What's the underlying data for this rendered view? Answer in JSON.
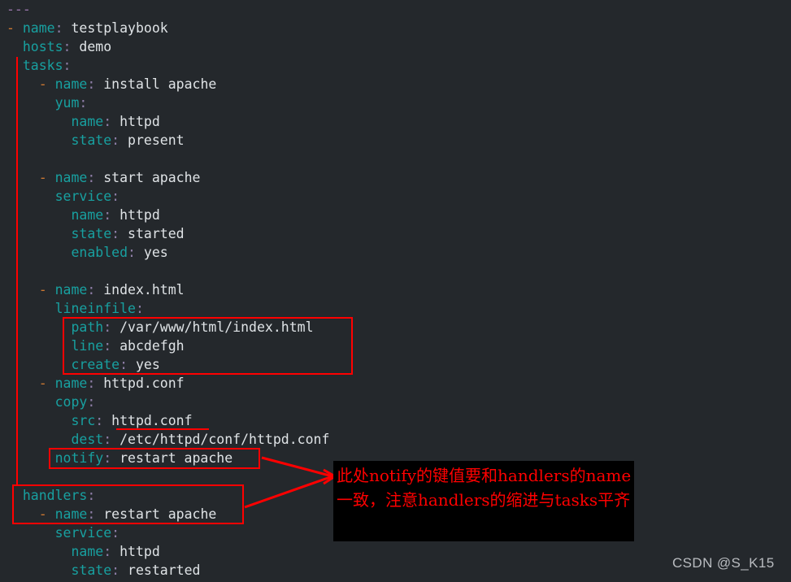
{
  "editor": {
    "background_color": "#24282c",
    "key_color": "#18a0a0",
    "value_color": "#dfe3e6",
    "dash_color": "#cc7832",
    "colon_color": "#8f7fa8",
    "doc_marker_color": "#9876aa",
    "annotation_color": "#ff0000",
    "lines": [
      {
        "indent": "",
        "dash": "",
        "key": "",
        "colon": "",
        "value": "",
        "doc": "---"
      },
      {
        "indent": "",
        "dash": "- ",
        "key": "name",
        "colon": ":",
        "value": " testplaybook"
      },
      {
        "indent": "  ",
        "dash": "",
        "key": "hosts",
        "colon": ":",
        "value": " demo"
      },
      {
        "indent": "  ",
        "dash": "",
        "key": "tasks",
        "colon": ":",
        "value": ""
      },
      {
        "indent": "    ",
        "dash": "- ",
        "key": "name",
        "colon": ":",
        "value": " install apache"
      },
      {
        "indent": "      ",
        "dash": "",
        "key": "yum",
        "colon": ":",
        "value": ""
      },
      {
        "indent": "        ",
        "dash": "",
        "key": "name",
        "colon": ":",
        "value": " httpd"
      },
      {
        "indent": "        ",
        "dash": "",
        "key": "state",
        "colon": ":",
        "value": " present"
      },
      {
        "indent": "",
        "dash": "",
        "key": "",
        "colon": "",
        "value": ""
      },
      {
        "indent": "    ",
        "dash": "- ",
        "key": "name",
        "colon": ":",
        "value": " start apache"
      },
      {
        "indent": "      ",
        "dash": "",
        "key": "service",
        "colon": ":",
        "value": ""
      },
      {
        "indent": "        ",
        "dash": "",
        "key": "name",
        "colon": ":",
        "value": " httpd"
      },
      {
        "indent": "        ",
        "dash": "",
        "key": "state",
        "colon": ":",
        "value": " started"
      },
      {
        "indent": "        ",
        "dash": "",
        "key": "enabled",
        "colon": ":",
        "value": " yes"
      },
      {
        "indent": "",
        "dash": "",
        "key": "",
        "colon": "",
        "value": ""
      },
      {
        "indent": "    ",
        "dash": "- ",
        "key": "name",
        "colon": ":",
        "value": " index.html"
      },
      {
        "indent": "      ",
        "dash": "",
        "key": "lineinfile",
        "colon": ":",
        "value": ""
      },
      {
        "indent": "        ",
        "dash": "",
        "key": "path",
        "colon": ":",
        "value": " /var/www/html/index.html"
      },
      {
        "indent": "        ",
        "dash": "",
        "key": "line",
        "colon": ":",
        "value": " abcdefgh"
      },
      {
        "indent": "        ",
        "dash": "",
        "key": "create",
        "colon": ":",
        "value": " yes"
      },
      {
        "indent": "    ",
        "dash": "- ",
        "key": "name",
        "colon": ":",
        "value": " httpd.conf"
      },
      {
        "indent": "      ",
        "dash": "",
        "key": "copy",
        "colon": ":",
        "value": ""
      },
      {
        "indent": "        ",
        "dash": "",
        "key": "src",
        "colon": ":",
        "value": " httpd.conf"
      },
      {
        "indent": "        ",
        "dash": "",
        "key": "dest",
        "colon": ":",
        "value": " /etc/httpd/conf/httpd.conf"
      },
      {
        "indent": "      ",
        "dash": "",
        "key": "notify",
        "colon": ":",
        "value": " restart apache"
      },
      {
        "indent": "",
        "dash": "",
        "key": "",
        "colon": "",
        "value": ""
      },
      {
        "indent": "  ",
        "dash": "",
        "key": "handlers",
        "colon": ":",
        "value": ""
      },
      {
        "indent": "    ",
        "dash": "- ",
        "key": "name",
        "colon": ":",
        "value": " restart apache"
      },
      {
        "indent": "      ",
        "dash": "",
        "key": "service",
        "colon": ":",
        "value": ""
      },
      {
        "indent": "        ",
        "dash": "",
        "key": "name",
        "colon": ":",
        "value": " httpd"
      },
      {
        "indent": "        ",
        "dash": "",
        "key": "state",
        "colon": ":",
        "value": " restarted"
      }
    ]
  },
  "annotations": {
    "note": "此处notify的键值要和handlers的name一致，注意handlers的缩进与tasks平齐"
  },
  "watermark": {
    "text": "CSDN @S_K15"
  }
}
